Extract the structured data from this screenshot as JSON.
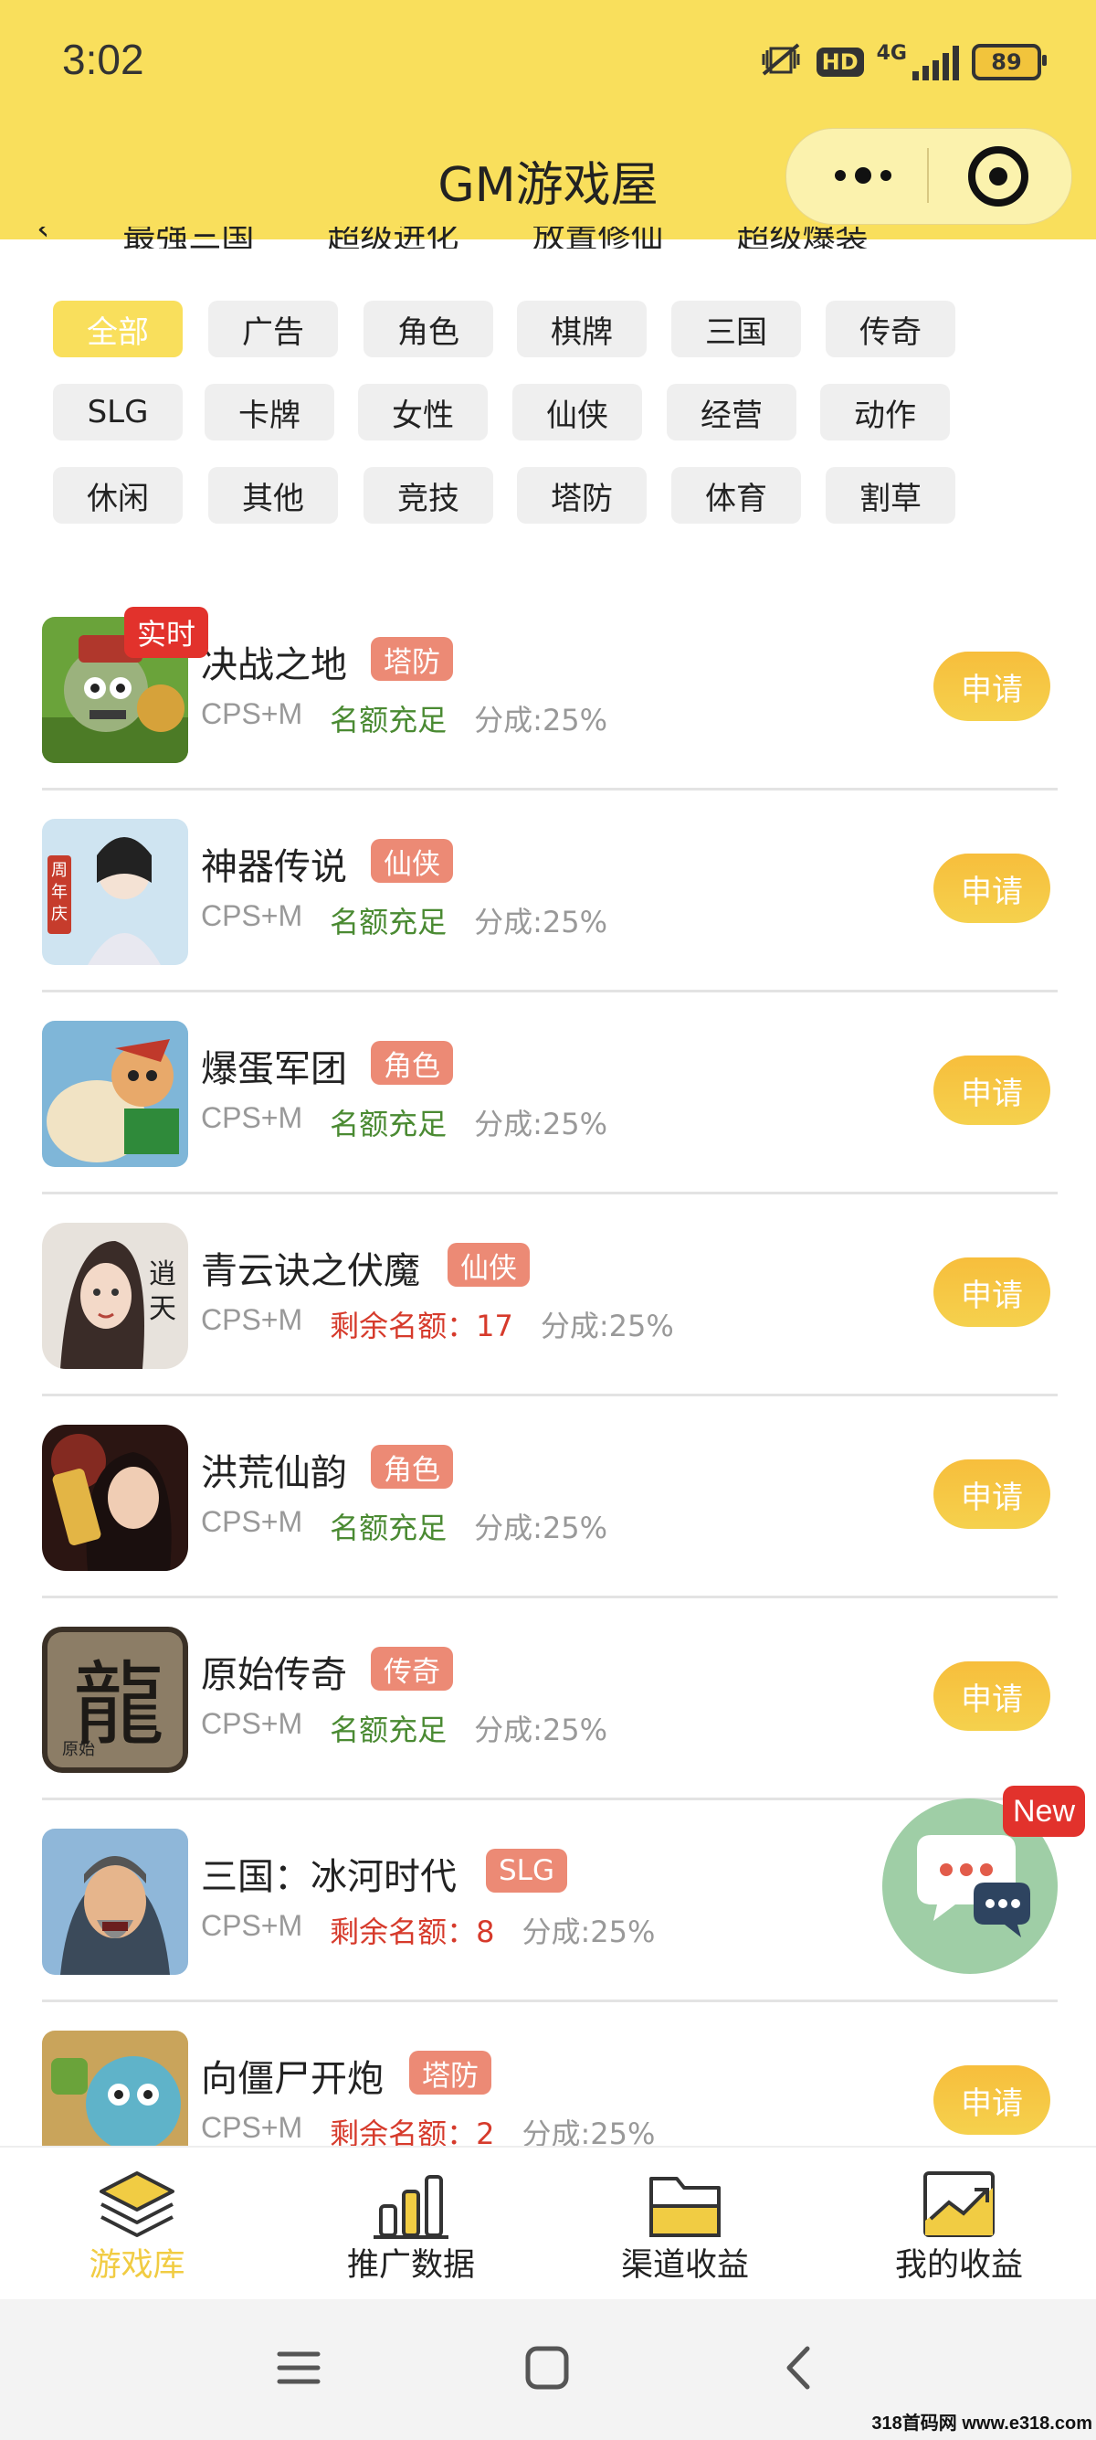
{
  "status_bar": {
    "time": "3:02",
    "network": "4G",
    "hd": "HD",
    "battery": "89"
  },
  "header": {
    "title": "GM游戏屋"
  },
  "top_category_partial": [
    "最强三国",
    "超级进化",
    "放置修仙",
    "超级爆装"
  ],
  "filters": [
    [
      "全部",
      "广告",
      "角色",
      "棋牌",
      "三国",
      "传奇"
    ],
    [
      "SLG",
      "卡牌",
      "女性",
      "仙侠",
      "经营",
      "动作"
    ],
    [
      "休闲",
      "其他",
      "竞技",
      "塔防",
      "体育",
      "割草"
    ]
  ],
  "active_filter": "全部",
  "live_badge": "实时",
  "apply_label": "申请",
  "games": [
    {
      "name": "决战之地",
      "tag": "塔防",
      "mode": "CPS+M",
      "quota": "名额充足",
      "quota_type": "green",
      "share": "分成:25%"
    },
    {
      "name": "神器传说",
      "tag": "仙侠",
      "mode": "CPS+M",
      "quota": "名额充足",
      "quota_type": "green",
      "share": "分成:25%"
    },
    {
      "name": "爆蛋军团",
      "tag": "角色",
      "mode": "CPS+M",
      "quota": "名额充足",
      "quota_type": "green",
      "share": "分成:25%"
    },
    {
      "name": "青云诀之伏魔",
      "tag": "仙侠",
      "mode": "CPS+M",
      "quota": "剩余名额：17",
      "quota_type": "red",
      "share": "分成:25%"
    },
    {
      "name": "洪荒仙韵",
      "tag": "角色",
      "mode": "CPS+M",
      "quota": "名额充足",
      "quota_type": "green",
      "share": "分成:25%"
    },
    {
      "name": "原始传奇",
      "tag": "传奇",
      "mode": "CPS+M",
      "quota": "名额充足",
      "quota_type": "green",
      "share": "分成:25%"
    },
    {
      "name": "三国：冰河时代",
      "tag": "SLG",
      "mode": "CPS+M",
      "quota": "剩余名额：8",
      "quota_type": "red",
      "share": "分成:25%"
    },
    {
      "name": "向僵尸开炮",
      "tag": "塔防",
      "mode": "CPS+M",
      "quota": "剩余名额：2",
      "quota_type": "red",
      "share": "分成:25%"
    }
  ],
  "chat_badge": "New",
  "tabs": [
    {
      "label": "游戏库",
      "icon": "layers-icon",
      "active": true
    },
    {
      "label": "推广数据",
      "icon": "bar-chart-icon",
      "active": false
    },
    {
      "label": "渠道收益",
      "icon": "folder-icon",
      "active": false
    },
    {
      "label": "我的收益",
      "icon": "trend-chart-icon",
      "active": false
    }
  ],
  "icon_text": {
    "game2": "周年庆",
    "game4": "逍遥天",
    "game6_main": "龍",
    "game6_sub": "原始"
  },
  "watermark": "318首码网 www.e318.com",
  "colors": {
    "header": "#f9df5c",
    "tag": "#ec8a75",
    "apply": "#f7be3c",
    "quota_green": "#4a8a32",
    "quota_red": "#d63a2b",
    "badge": "#e2322c",
    "chat_fab": "#9fcea6"
  }
}
